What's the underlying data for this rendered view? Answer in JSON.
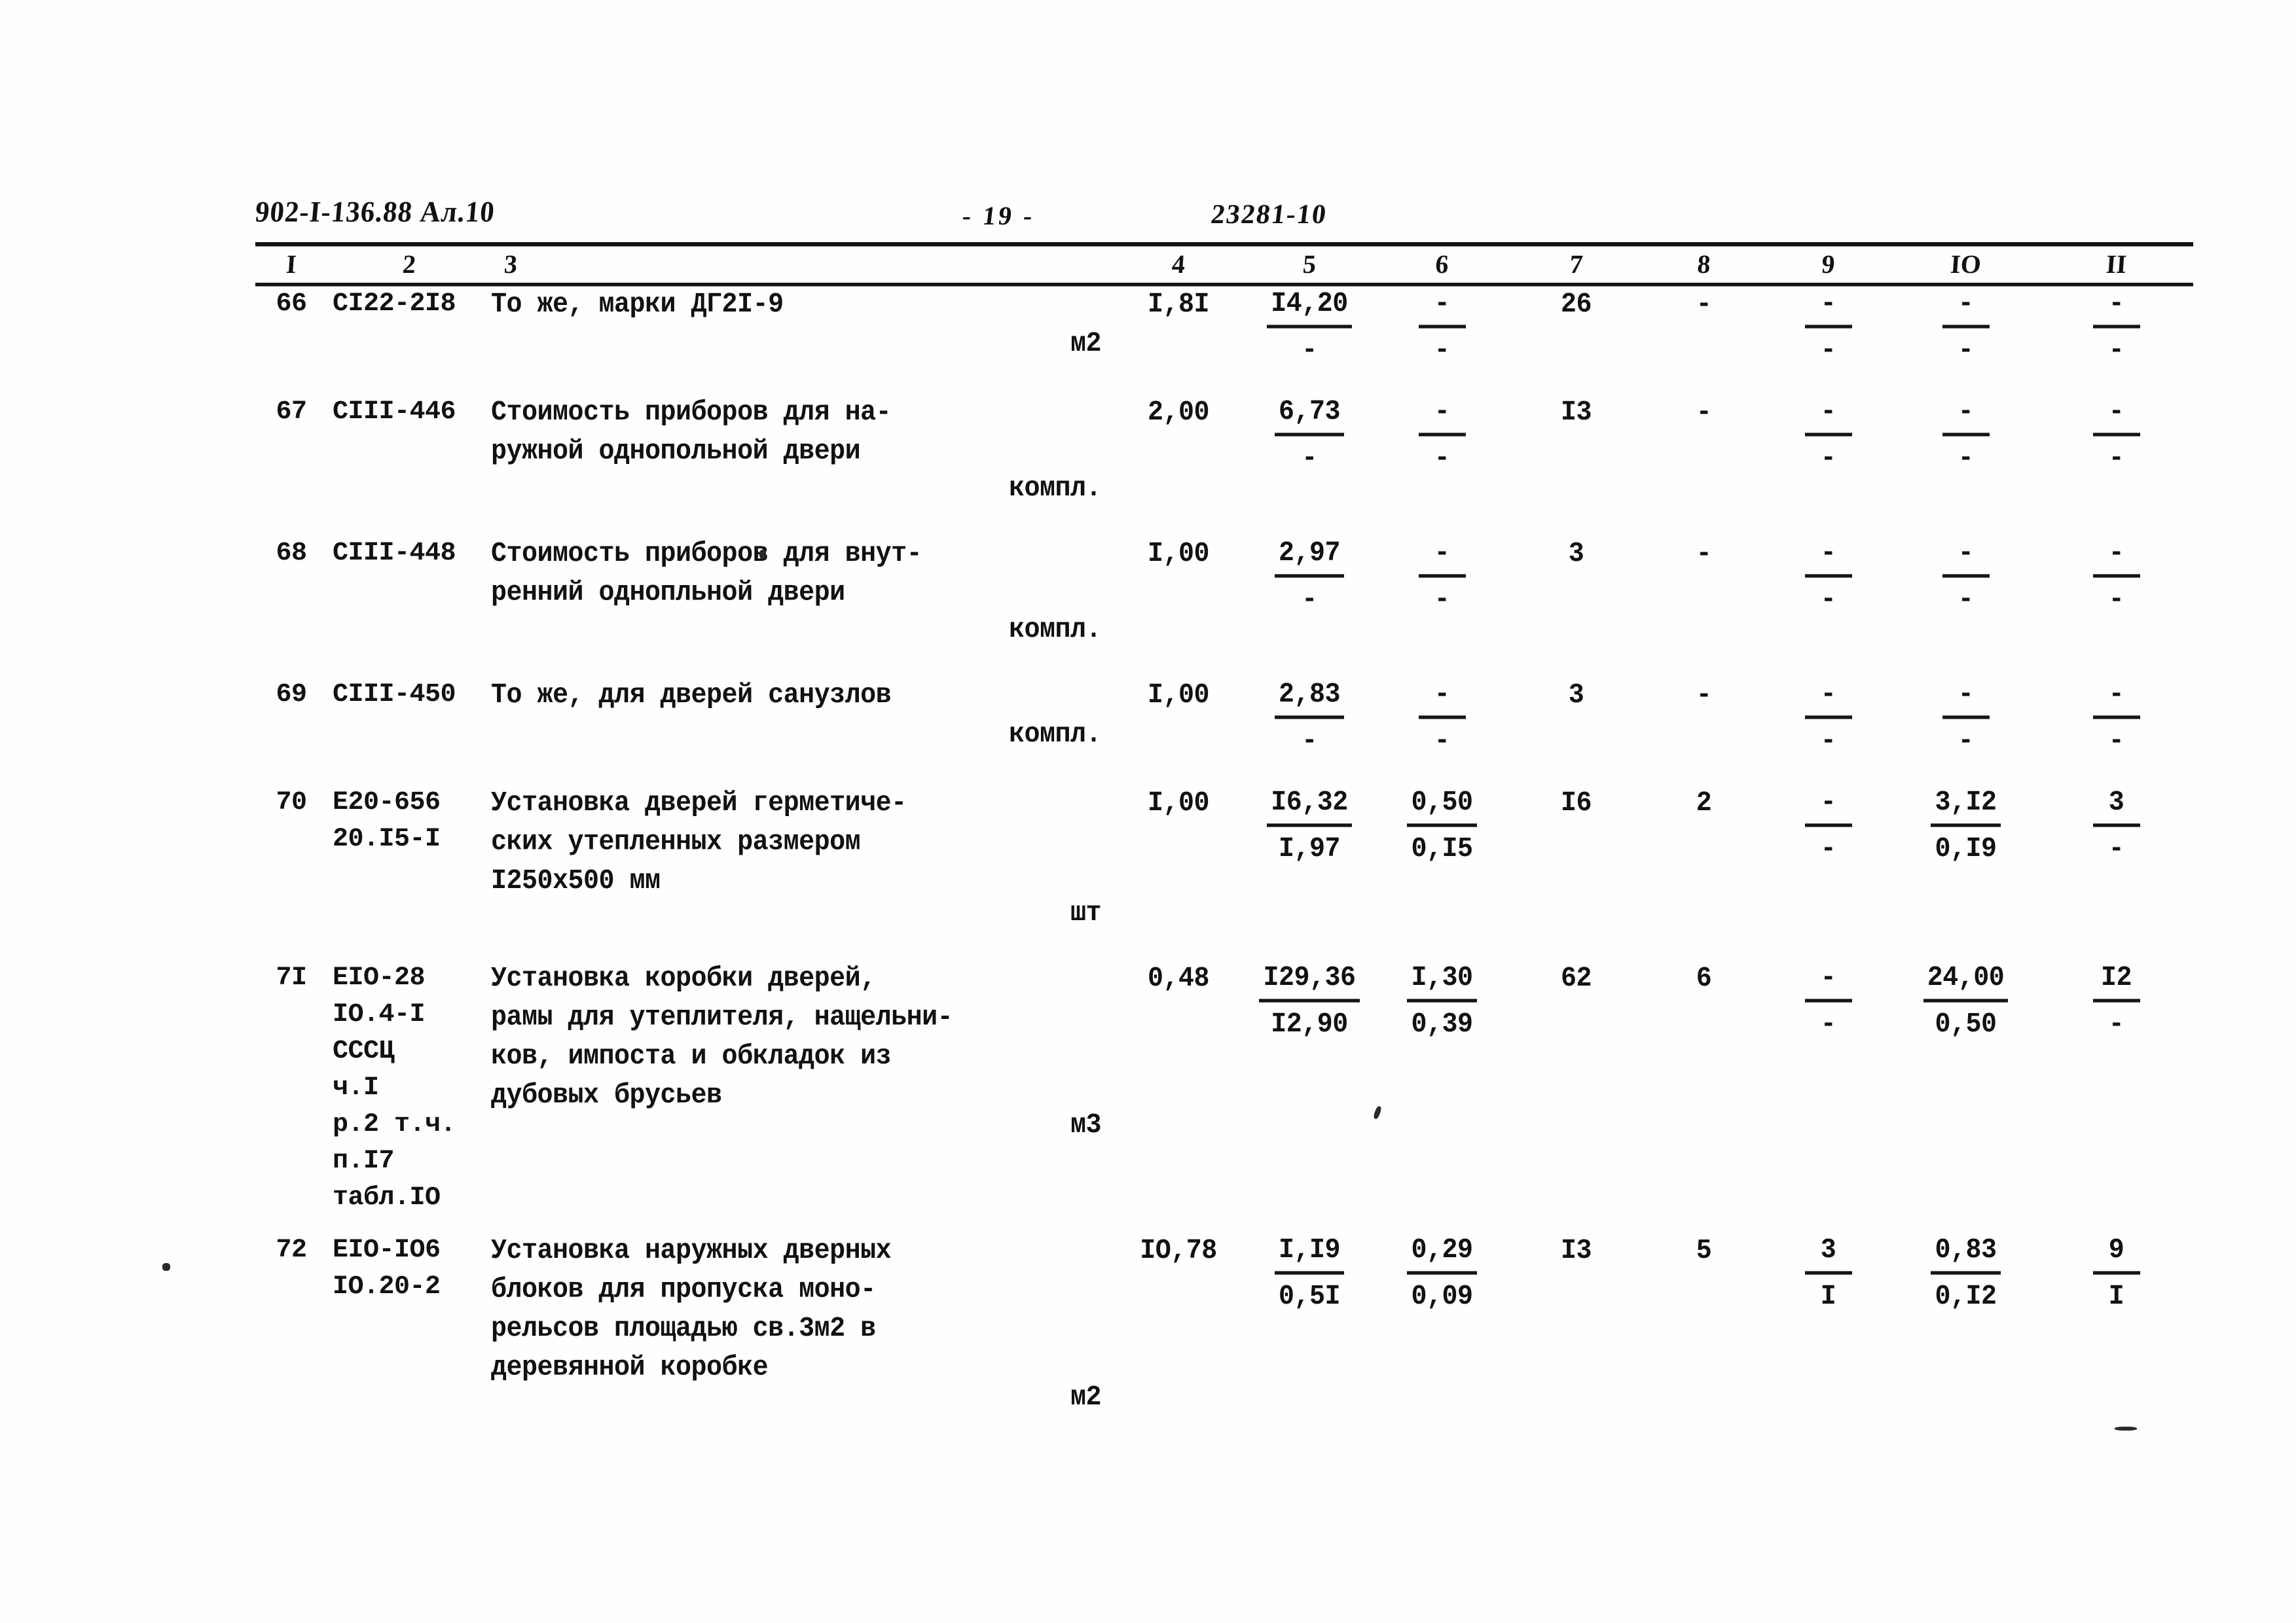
{
  "header": {
    "doc_code": "902-I-136.88 Ал.10",
    "page_label": "- 19 -",
    "sheet_number": "23281-10"
  },
  "table": {
    "column_headers": [
      "I",
      "2",
      "3",
      "4",
      "5",
      "6",
      "7",
      "8",
      "9",
      "IO",
      "II"
    ],
    "rows": [
      {
        "num": "66",
        "code": "СI22-2I8",
        "description": "То же, марки ДГ2I-9",
        "unit": "м2",
        "c4": "I,8I",
        "c5_top": "I4,20",
        "c5_bot": "-",
        "c6_top": "-",
        "c6_bot": "-",
        "c7": "26",
        "c8": "-",
        "c9_top": "-",
        "c9_bot": "-",
        "c10_top": "-",
        "c10_bot": "-",
        "c11_top": "-",
        "c11_bot": "-"
      },
      {
        "num": "67",
        "code": "СIII-446",
        "description": "Стоимость приборов для на-\nружной однопольной двери",
        "unit": "компл.",
        "c4": "2,00",
        "c5_top": "6,73",
        "c5_bot": "-",
        "c6_top": "-",
        "c6_bot": "-",
        "c7": "I3",
        "c8": "-",
        "c9_top": "-",
        "c9_bot": "-",
        "c10_top": "-",
        "c10_bot": "-",
        "c11_top": "-",
        "c11_bot": "-"
      },
      {
        "num": "68",
        "code": "СIII-448",
        "description": "Стоимость приборов для внут-\nренний однопльной двери",
        "unit": "компл.",
        "c4": "I,00",
        "c5_top": "2,97",
        "c5_bot": "-",
        "c6_top": "-",
        "c6_bot": "-",
        "c7": "3",
        "c8": "-",
        "c9_top": "-",
        "c9_bot": "-",
        "c10_top": "-",
        "c10_bot": "-",
        "c11_top": "-",
        "c11_bot": "-"
      },
      {
        "num": "69",
        "code": "СIII-450",
        "description": "То же, для дверей санузлов",
        "unit": "компл.",
        "c4": "I,00",
        "c5_top": "2,83",
        "c5_bot": "-",
        "c6_top": "-",
        "c6_bot": "-",
        "c7": "3",
        "c8": "-",
        "c9_top": "-",
        "c9_bot": "-",
        "c10_top": "-",
        "c10_bot": "-",
        "c11_top": "-",
        "c11_bot": "-"
      },
      {
        "num": "70",
        "code": "Е20-656\n20.I5-I",
        "description": "Установка дверей герметиче-\nских утепленных размером\nI250х500 мм",
        "unit": "шт",
        "c4": "I,00",
        "c5_top": "I6,32",
        "c5_bot": "I,97",
        "c6_top": "0,50",
        "c6_bot": "0,I5",
        "c7": "I6",
        "c8": "2",
        "c9_top": "-",
        "c9_bot": "-",
        "c10_top": "3,I2",
        "c10_bot": "0,I9",
        "c11_top": "3",
        "c11_bot": "-"
      },
      {
        "num": "7I",
        "code": "ЕIO-28\nIO.4-I\nСССЦ\nч.I\nр.2 т.ч.\nп.I7\nтабл.IO",
        "description": "Установка коробки дверей,\nрамы для утеплителя, нащельни-\nков, импоста и обкладок из\nдубовых брусьев",
        "unit": "м3",
        "c4": "0,48",
        "c5_top": "I29,36",
        "c5_bot": "I2,90",
        "c6_top": "I,30",
        "c6_bot": "0,39",
        "c7": "62",
        "c8": "6",
        "c9_top": "-",
        "c9_bot": "-",
        "c10_top": "24,00",
        "c10_bot": "0,50",
        "c11_top": "I2",
        "c11_bot": "-"
      },
      {
        "num": "72",
        "code": "ЕIO-IО6\nIO.20-2",
        "description": "Установка наружных дверных\nблоков для пропуска моно-\nрельсов площадью  св.3м2 в\nдеревянной коробке",
        "unit": "м2",
        "c4": "IО,78",
        "c5_top": "I,I9",
        "c5_bot": "0,5I",
        "c6_top": "0,29",
        "c6_bot": "0,09",
        "c7": "I3",
        "c8": "5",
        "c9_top": "3",
        "c9_bot": "I",
        "c10_top": "0,83",
        "c10_bot": "0,I2",
        "c11_top": "9",
        "c11_bot": "I"
      }
    ]
  }
}
